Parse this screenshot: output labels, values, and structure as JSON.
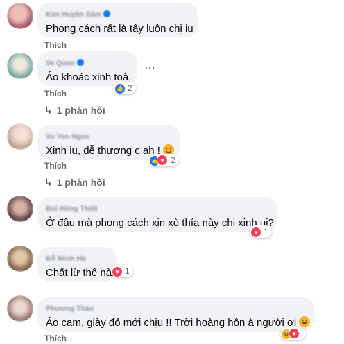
{
  "action_labels": {
    "like": "Thích"
  },
  "comments": [
    {
      "author": "Kim Huyền Sâm",
      "verified": true,
      "text": "Phong cách rất là tây luôn chị iu",
      "avatar_color": "#b06070"
    },
    {
      "author": "Ve Quoc",
      "verified": true,
      "text": "Áo khoác xinh toả.",
      "avatar_color": "#7fb0a0",
      "reactions": {
        "types": [
          "like"
        ],
        "count": "2"
      },
      "replies": "1 phản hồi",
      "more_icon": "⋯"
    },
    {
      "author": "Vu Yen Ngoc",
      "text": "Xinh iu, dễ thương c ah !",
      "emoji": "heart-eyes-emoji",
      "avatar_color": "#c8a898",
      "reactions": {
        "types": [
          "like",
          "love"
        ],
        "count": "2"
      },
      "replies": "1 phản hồi"
    },
    {
      "author": "Bùi Hồng Thiết",
      "text": "Ở đâu mà phong cách xịn xò thía này chị xinh ui?",
      "avatar_color": "#6a4a48",
      "reactions": {
        "types": [
          "love"
        ],
        "count": "1"
      }
    },
    {
      "author": "Đỗ Minh Hà",
      "text": "Chất lừ thế nài",
      "avatar_color": "#8a6a50",
      "reactions": {
        "types": [
          "love"
        ],
        "count": "1"
      }
    },
    {
      "author": "Phương Thảo",
      "text": "Áo cam, giày đỏ mới chịu !! Trời hoàng hôn à người ơi",
      "emoji": "grinning-emoji",
      "avatar_color": "#a08078",
      "reactions": {
        "types": [
          "haha",
          "love"
        ],
        "count": ""
      }
    }
  ],
  "colors": {
    "bubble": "#f0f2f5",
    "like_blue": "#1877f2",
    "love_red": "#f33e58",
    "meta_gray": "#65676b"
  }
}
